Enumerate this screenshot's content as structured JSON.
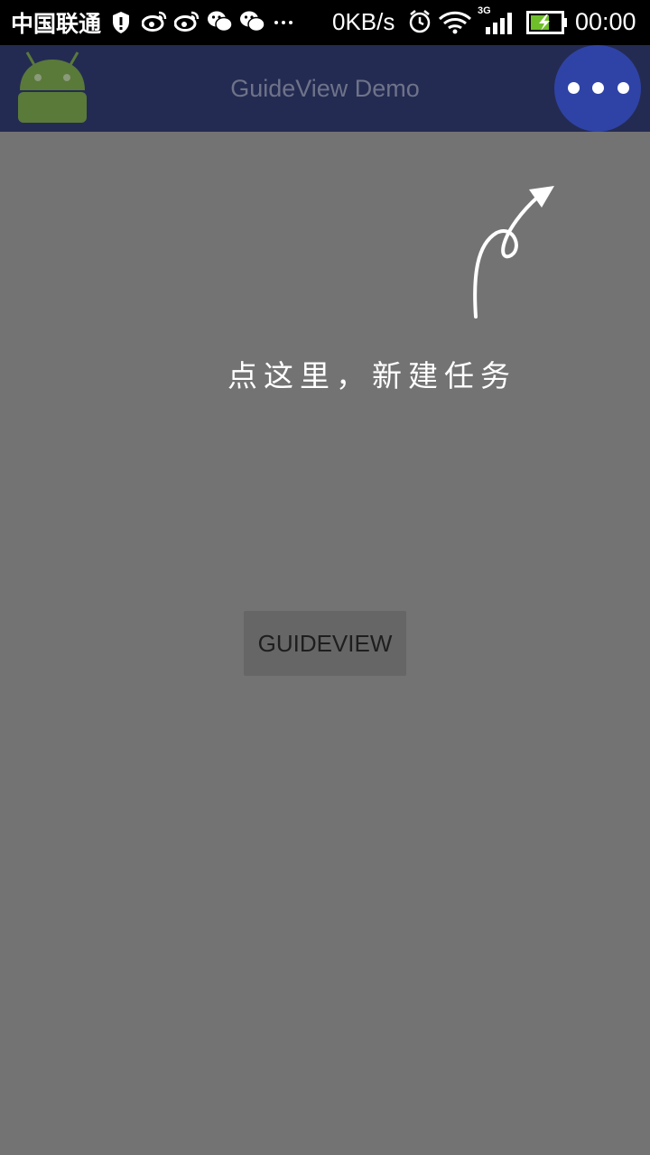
{
  "status_bar": {
    "carrier": "中国联通",
    "network_speed": "0KB/s",
    "network_type": "3G",
    "time": "00:00",
    "icons": [
      "shield-icon",
      "weibo-icon",
      "weibo-icon",
      "wechat-icon",
      "wechat-icon",
      "more-notifications-icon",
      "alarm-icon",
      "wifi-icon",
      "signal-icon",
      "battery-charging-icon"
    ]
  },
  "action_bar": {
    "title": "GuideView Demo",
    "app_icon": "android-icon",
    "overflow_icon": "more-dots-icon",
    "color": "#242b52",
    "highlight_color": "#2f43a6"
  },
  "guide": {
    "tip_text": "点这里，新建任务",
    "arrow_icon": "curved-arrow-icon"
  },
  "main": {
    "button_label": "GUIDEVIEW"
  },
  "colors": {
    "overlay_background": "#737373",
    "status_bar": "#000000"
  }
}
